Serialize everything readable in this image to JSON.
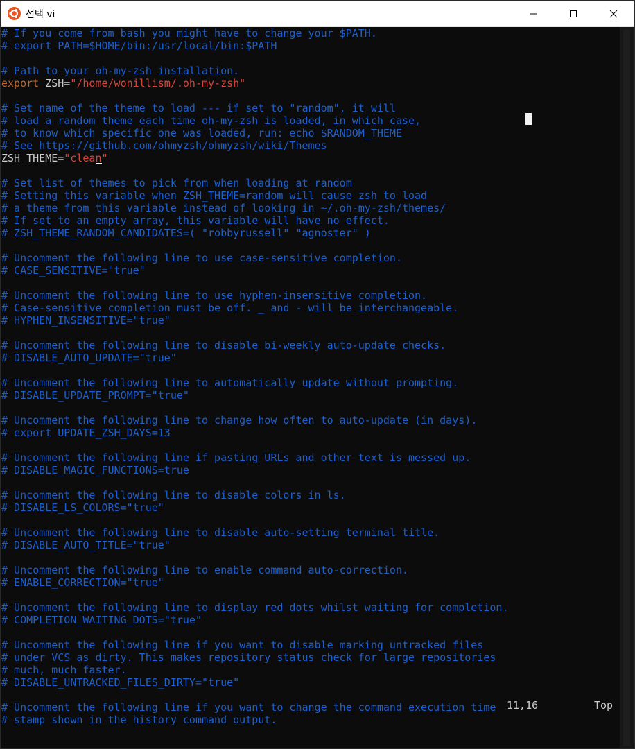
{
  "window": {
    "title": "선택 vi",
    "icon": "ubuntu-icon",
    "accent": "#e95420",
    "buttons": {
      "minimize": "minimize-icon",
      "maximize": "maximize-icon",
      "close": "close-icon"
    }
  },
  "editor": {
    "lines": [
      [
        {
          "t": "# If you come from bash you might have to change your $PATH.",
          "c": "comment"
        }
      ],
      [
        {
          "t": "# export PATH=$HOME/bin:/usr/local/bin:$PATH",
          "c": "comment"
        }
      ],
      [
        {
          "t": "",
          "c": "default"
        }
      ],
      [
        {
          "t": "# Path to your oh-my-zsh installation.",
          "c": "comment"
        }
      ],
      [
        {
          "t": "export",
          "c": "keyword"
        },
        {
          "t": " ZSH=",
          "c": "default"
        },
        {
          "t": "\"/home/wonillism/.oh-my-zsh\"",
          "c": "string"
        }
      ],
      [
        {
          "t": "",
          "c": "default"
        }
      ],
      [
        {
          "t": "# Set name of the theme to load --- if set to \"random\", it will",
          "c": "comment"
        }
      ],
      [
        {
          "t": "# load a random theme each time oh-my-zsh is loaded, in which case,",
          "c": "comment"
        }
      ],
      [
        {
          "t": "# to know which specific one was loaded, run: echo $RANDOM_THEME",
          "c": "comment"
        }
      ],
      [
        {
          "t": "# See https://github.com/ohmyzsh/ohmyzsh/wiki/Themes",
          "c": "comment"
        }
      ],
      [
        {
          "t": "ZSH_THEME=",
          "c": "default"
        },
        {
          "t": "\"clean",
          "c": "string"
        },
        {
          "t": "\"",
          "c": "string"
        }
      ],
      [
        {
          "t": "",
          "c": "default"
        }
      ],
      [
        {
          "t": "# Set list of themes to pick from when loading at random",
          "c": "comment"
        }
      ],
      [
        {
          "t": "# Setting this variable when ZSH_THEME=random will cause zsh to load",
          "c": "comment"
        }
      ],
      [
        {
          "t": "# a theme from this variable instead of looking in ~/.oh-my-zsh/themes/",
          "c": "comment"
        }
      ],
      [
        {
          "t": "# If set to an empty array, this variable will have no effect.",
          "c": "comment"
        }
      ],
      [
        {
          "t": "# ZSH_THEME_RANDOM_CANDIDATES=( \"robbyrussell\" \"agnoster\" )",
          "c": "comment"
        }
      ],
      [
        {
          "t": "",
          "c": "default"
        }
      ],
      [
        {
          "t": "# Uncomment the following line to use case-sensitive completion.",
          "c": "comment"
        }
      ],
      [
        {
          "t": "# CASE_SENSITIVE=\"true\"",
          "c": "comment"
        }
      ],
      [
        {
          "t": "",
          "c": "default"
        }
      ],
      [
        {
          "t": "# Uncomment the following line to use hyphen-insensitive completion.",
          "c": "comment"
        }
      ],
      [
        {
          "t": "# Case-sensitive completion must be off. _ and - will be interchangeable.",
          "c": "comment"
        }
      ],
      [
        {
          "t": "# HYPHEN_INSENSITIVE=\"true\"",
          "c": "comment"
        }
      ],
      [
        {
          "t": "",
          "c": "default"
        }
      ],
      [
        {
          "t": "# Uncomment the following line to disable bi-weekly auto-update checks.",
          "c": "comment"
        }
      ],
      [
        {
          "t": "# DISABLE_AUTO_UPDATE=\"true\"",
          "c": "comment"
        }
      ],
      [
        {
          "t": "",
          "c": "default"
        }
      ],
      [
        {
          "t": "# Uncomment the following line to automatically update without prompting.",
          "c": "comment"
        }
      ],
      [
        {
          "t": "# DISABLE_UPDATE_PROMPT=\"true\"",
          "c": "comment"
        }
      ],
      [
        {
          "t": "",
          "c": "default"
        }
      ],
      [
        {
          "t": "# Uncomment the following line to change how often to auto-update (in days).",
          "c": "comment"
        }
      ],
      [
        {
          "t": "# export UPDATE_ZSH_DAYS=13",
          "c": "comment"
        }
      ],
      [
        {
          "t": "",
          "c": "default"
        }
      ],
      [
        {
          "t": "# Uncomment the following line if pasting URLs and other text is messed up.",
          "c": "comment"
        }
      ],
      [
        {
          "t": "# DISABLE_MAGIC_FUNCTIONS=true",
          "c": "comment"
        }
      ],
      [
        {
          "t": "",
          "c": "default"
        }
      ],
      [
        {
          "t": "# Uncomment the following line to disable colors in ls.",
          "c": "comment"
        }
      ],
      [
        {
          "t": "# DISABLE_LS_COLORS=\"true\"",
          "c": "comment"
        }
      ],
      [
        {
          "t": "",
          "c": "default"
        }
      ],
      [
        {
          "t": "# Uncomment the following line to disable auto-setting terminal title.",
          "c": "comment"
        }
      ],
      [
        {
          "t": "# DISABLE_AUTO_TITLE=\"true\"",
          "c": "comment"
        }
      ],
      [
        {
          "t": "",
          "c": "default"
        }
      ],
      [
        {
          "t": "# Uncomment the following line to enable command auto-correction.",
          "c": "comment"
        }
      ],
      [
        {
          "t": "# ENABLE_CORRECTION=\"true\"",
          "c": "comment"
        }
      ],
      [
        {
          "t": "",
          "c": "default"
        }
      ],
      [
        {
          "t": "# Uncomment the following line to display red dots whilst waiting for completion.",
          "c": "comment"
        }
      ],
      [
        {
          "t": "# COMPLETION_WAITING_DOTS=\"true\"",
          "c": "comment"
        }
      ],
      [
        {
          "t": "",
          "c": "default"
        }
      ],
      [
        {
          "t": "# Uncomment the following line if you want to disable marking untracked files",
          "c": "comment"
        }
      ],
      [
        {
          "t": "# under VCS as dirty. This makes repository status check for large repositories",
          "c": "comment"
        }
      ],
      [
        {
          "t": "# much, much faster.",
          "c": "comment"
        }
      ],
      [
        {
          "t": "# DISABLE_UNTRACKED_FILES_DIRTY=\"true\"",
          "c": "comment"
        }
      ],
      [
        {
          "t": "",
          "c": "default"
        }
      ],
      [
        {
          "t": "# Uncomment the following line if you want to change the command execution time",
          "c": "comment"
        }
      ],
      [
        {
          "t": "# stamp shown in the history command output.",
          "c": "comment"
        }
      ]
    ],
    "cursor_line": 10
  },
  "status": {
    "position": "11,16",
    "scroll": "Top"
  },
  "colors": {
    "background": "#0c0c0c",
    "comment": "#1b5fd0",
    "default": "#cccccc",
    "keyword": "#c0662a",
    "string": "#d9443a"
  }
}
